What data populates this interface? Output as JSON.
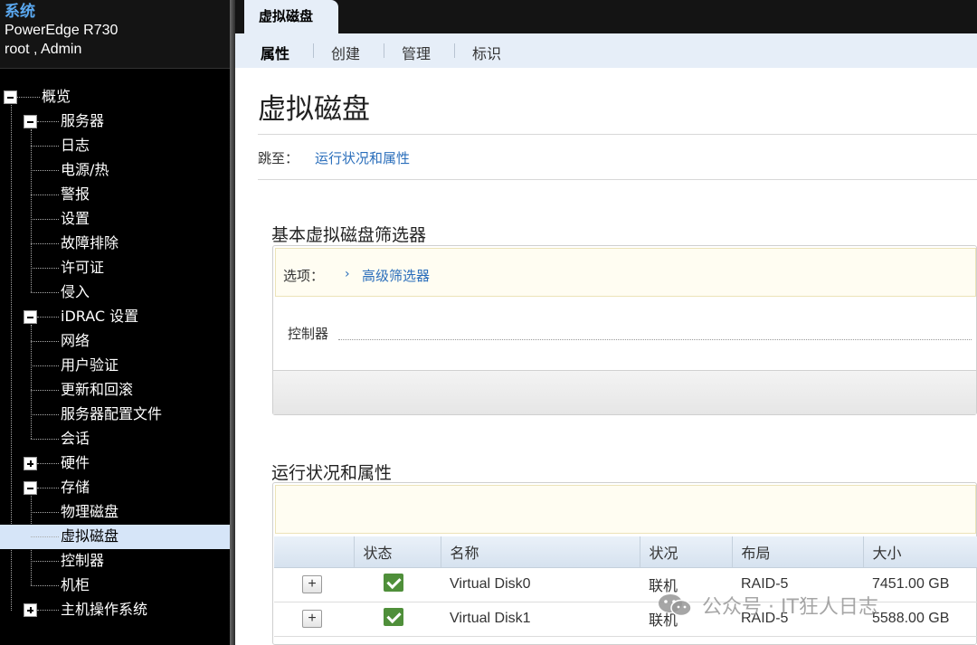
{
  "sidebar": {
    "system_title": "系统",
    "model": "PowerEdge R730",
    "user": "root , Admin",
    "tree": [
      {
        "label": "概览",
        "level": 0,
        "toggle": "minus"
      },
      {
        "label": "服务器",
        "level": 1,
        "toggle": "minus"
      },
      {
        "label": "日志",
        "level": 2
      },
      {
        "label": "电源/热",
        "level": 2
      },
      {
        "label": "警报",
        "level": 2
      },
      {
        "label": "设置",
        "level": 2
      },
      {
        "label": "故障排除",
        "level": 2
      },
      {
        "label": "许可证",
        "level": 2
      },
      {
        "label": "侵入",
        "level": 2
      },
      {
        "label": "iDRAC 设置",
        "level": 1,
        "toggle": "minus"
      },
      {
        "label": "网络",
        "level": 2
      },
      {
        "label": "用户验证",
        "level": 2
      },
      {
        "label": "更新和回滚",
        "level": 2
      },
      {
        "label": "服务器配置文件",
        "level": 2
      },
      {
        "label": "会话",
        "level": 2
      },
      {
        "label": "硬件",
        "level": 1,
        "toggle": "plus"
      },
      {
        "label": "存储",
        "level": 1,
        "toggle": "minus"
      },
      {
        "label": "物理磁盘",
        "level": 2
      },
      {
        "label": "虚拟磁盘",
        "level": 2,
        "selected": true
      },
      {
        "label": "控制器",
        "level": 2
      },
      {
        "label": "机柜",
        "level": 2
      },
      {
        "label": "主机操作系统",
        "level": 1,
        "toggle": "plus"
      }
    ]
  },
  "tabs": {
    "active": "虚拟磁盘"
  },
  "subnav": [
    "属性",
    "创建",
    "管理",
    "标识"
  ],
  "page": {
    "title": "虚拟磁盘",
    "jump_label": "跳至：",
    "jump_link": "运行状况和属性"
  },
  "filter": {
    "title": "基本虚拟磁盘筛选器",
    "options_label": "选项：",
    "advanced_link": "高级筛选器",
    "controller_label": "控制器"
  },
  "health": {
    "title": "运行状况和属性",
    "columns": [
      "",
      "状态",
      "名称",
      "状况",
      "布局",
      "大小"
    ],
    "rows": [
      {
        "name": "Virtual Disk0",
        "condition": "联机",
        "layout": "RAID-5",
        "size": "7451.00 GB"
      },
      {
        "name": "Virtual Disk1",
        "condition": "联机",
        "layout": "RAID-5",
        "size": "5588.00 GB"
      }
    ]
  },
  "watermark": "公众号 · IT狂人日志",
  "colors": {
    "sidebar_bg": "#000000",
    "selected_bg": "#d6e5f8",
    "link": "#2a6ebb",
    "status_ok": "#4f8f3a",
    "subnav_bg": "#e6eef8"
  }
}
